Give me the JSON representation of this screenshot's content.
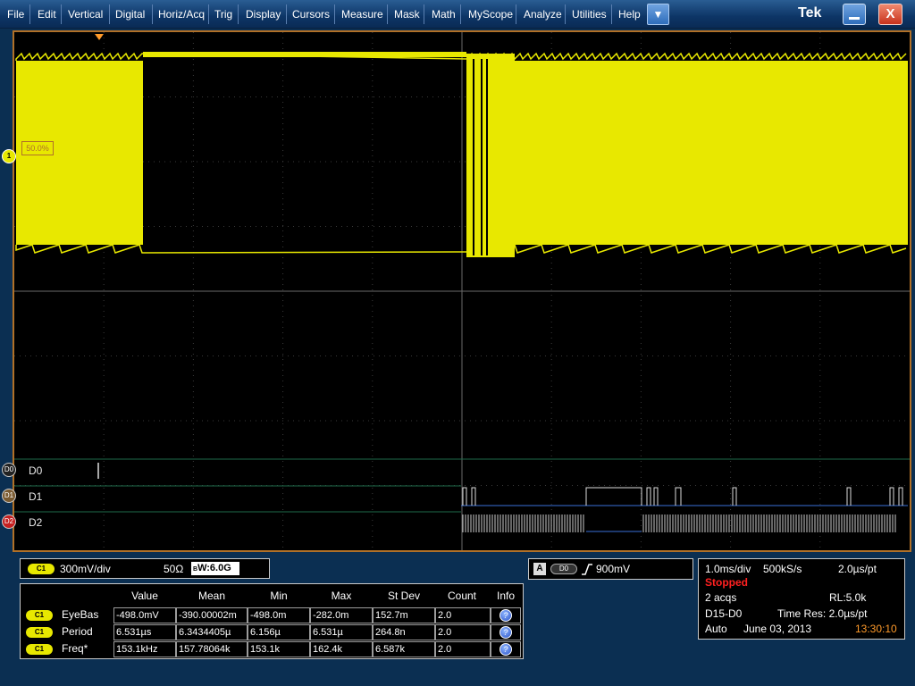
{
  "menu": [
    "File",
    "Edit",
    "Vertical",
    "Digital",
    "Horiz/Acq",
    "Trig",
    "Display",
    "Cursors",
    "Measure",
    "Mask",
    "Math",
    "MyScope",
    "Analyze",
    "Utilities",
    "Help"
  ],
  "titlebar": {
    "logo": "Tek",
    "dropdown_icon": "chevron-down-icon",
    "minimize_icon": "minimize-icon",
    "close_label": "X"
  },
  "colors": {
    "ch1": "#e8e800",
    "digital_line": "#3a6fd8",
    "frame": "#b07028",
    "stopped": "#ff2020",
    "time": "#ff9a2a"
  },
  "screen": {
    "ch1_marker": "1",
    "ch1_level": "50.0%",
    "digital": [
      {
        "tag": "D0",
        "label": "D0"
      },
      {
        "tag": "D1",
        "label": "D1"
      },
      {
        "tag": "D2",
        "label": "D2"
      }
    ]
  },
  "channel_panel": {
    "badge": "C1",
    "scale": "300mV/div",
    "impedance": "50Ω",
    "bw_label": "W:6.0G",
    "bw_prefix": "B"
  },
  "measurements": {
    "columns": [
      "Value",
      "Mean",
      "Min",
      "Max",
      "St Dev",
      "Count",
      "Info"
    ],
    "rows": [
      {
        "badge": "C1",
        "name": "EyeBas",
        "value": "-498.0mV",
        "mean": "-390.00002m",
        "min": "-498.0m",
        "max": "-282.0m",
        "stdev": "152.7m",
        "count": "2.0"
      },
      {
        "badge": "C1",
        "name": "Period",
        "value": "6.531µs",
        "mean": "6.3434405µ",
        "min": "6.156µ",
        "max": "6.531µ",
        "stdev": "264.8n",
        "count": "2.0"
      },
      {
        "badge": "C1",
        "name": "Freq*",
        "value": "153.1kHz",
        "mean": "157.78064k",
        "min": "153.1k",
        "max": "162.4k",
        "stdev": "6.587k",
        "count": "2.0"
      }
    ]
  },
  "trigger": {
    "mode_badge": "A",
    "source": "D0",
    "slope_icon": "rising-edge-icon",
    "level": "900mV"
  },
  "acquisition": {
    "timebase": "1.0ms/div",
    "sample_rate": "500kS/s",
    "resolution_per_pt": "2.0µs/pt",
    "state": "Stopped",
    "acqs": "2 acqs",
    "record_length": "RL:5.0k",
    "bus": "D15-D0",
    "time_res": "Time Res: 2.0µs/pt",
    "mode": "Auto",
    "date": "June 03, 2013",
    "time": "13:30:10"
  }
}
